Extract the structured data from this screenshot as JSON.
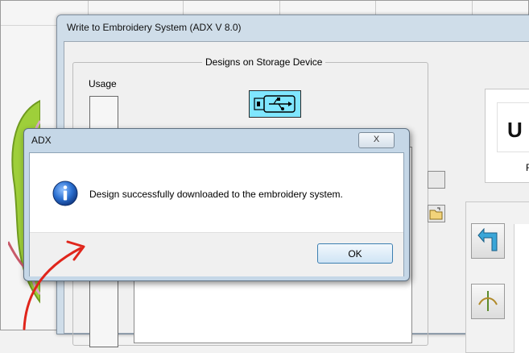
{
  "main_window": {
    "title": "Write to Embroidery System (ADX V 8.0)",
    "group_title": "Designs on Storage Device",
    "usage_label": "Usage",
    "usb_icon": "usb-drive-icon",
    "logo_text": "U",
    "logo_sub": "R"
  },
  "dialog": {
    "title": "ADX",
    "close_label": "X",
    "icon": "info-icon",
    "message": "Design successfully downloaded to the embroidery system.",
    "ok_label": "OK"
  },
  "colors": {
    "usb_button_bg": "#7fe6ff",
    "annotation_red": "#e0251b",
    "info_blue": "#1f5fb8",
    "window_frame": "#cfdde9"
  }
}
